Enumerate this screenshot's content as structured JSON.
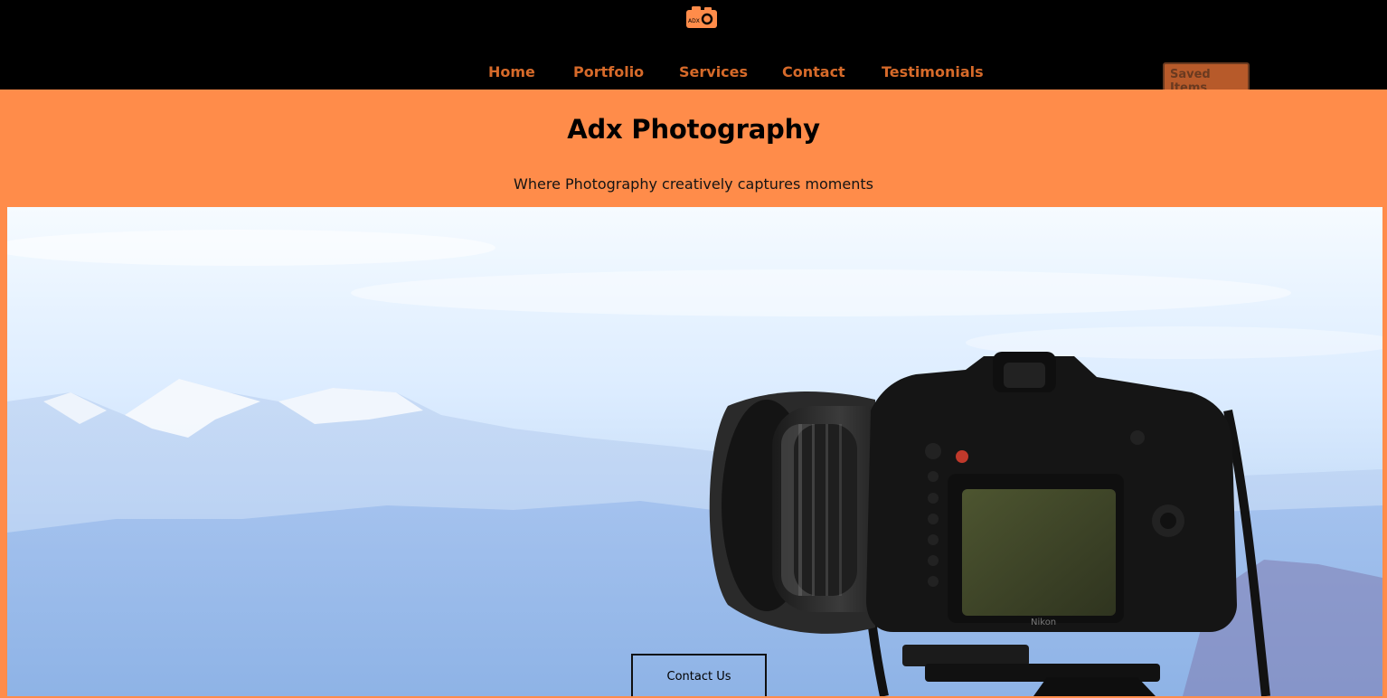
{
  "header": {
    "logo_text": "ADX",
    "logo_icon": "camera-icon",
    "nav": [
      {
        "label": "Home"
      },
      {
        "label": "Portfolio"
      },
      {
        "label": "Services"
      },
      {
        "label": "Contact"
      },
      {
        "label": "Testimonials"
      }
    ],
    "saved_items_label": "Saved Items"
  },
  "hero": {
    "title": "Adx Photography",
    "subtitle": "Where Photography creatively captures moments",
    "image": "camera-on-tripod-mountain-landscape",
    "camera_brand": "Nikon",
    "contact_button_label": "Contact Us"
  },
  "colors": {
    "brand_orange": "#ff8c4a",
    "nav_text": "#d66a2a",
    "header_bg": "#000000"
  }
}
